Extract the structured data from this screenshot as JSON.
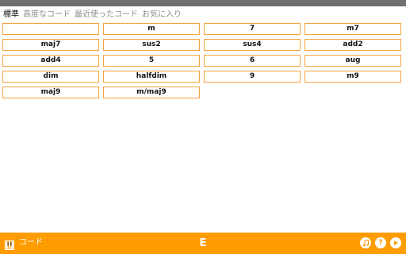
{
  "tabs": [
    {
      "label": "標準",
      "active": true
    },
    {
      "label": "高度なコード",
      "active": false
    },
    {
      "label": "最近使ったコード",
      "active": false
    },
    {
      "label": "お気に入り",
      "active": false
    }
  ],
  "chords": [
    "",
    "m",
    "7",
    "m7",
    "maj7",
    "sus2",
    "sus4",
    "add2",
    "add4",
    "5",
    "6",
    "aug",
    "dim",
    "halfdim",
    "9",
    "m9",
    "maj9",
    "m/maj9"
  ],
  "bottom_bar": {
    "label": "コード",
    "key": "E",
    "help_label": "?",
    "icons": [
      "piano-icon",
      "music-note-icon",
      "help-icon",
      "play-icon"
    ]
  },
  "colors": {
    "accent": "#ff9c00",
    "button_border": "#f5a33c",
    "status_strip": "#6f6f6f",
    "inactive_tab": "#8c8c8c"
  }
}
